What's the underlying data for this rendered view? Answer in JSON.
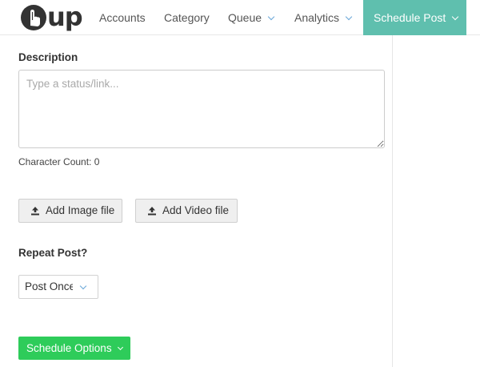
{
  "brand": {
    "logo_text": "up",
    "accent_color": "#5fbfae"
  },
  "nav": {
    "accounts": "Accounts",
    "category": "Category",
    "queue": "Queue",
    "analytics": "Analytics",
    "schedule_post": "Schedule Post"
  },
  "form": {
    "description_label": "Description",
    "description_placeholder": "Type a status/link...",
    "description_value": "",
    "char_count_text": "Character Count: 0",
    "add_image_label": "Add Image file",
    "add_video_label": "Add Video file",
    "repeat_label": "Repeat Post?",
    "repeat_selected": "Post Once",
    "schedule_options_label": "Schedule Options",
    "schedule_button_color": "#2ecc5a"
  },
  "icons": {
    "nav_dropdown": "chevron-down-icon",
    "upload": "upload-icon",
    "logo": "hand-pointer-logo-icon"
  }
}
